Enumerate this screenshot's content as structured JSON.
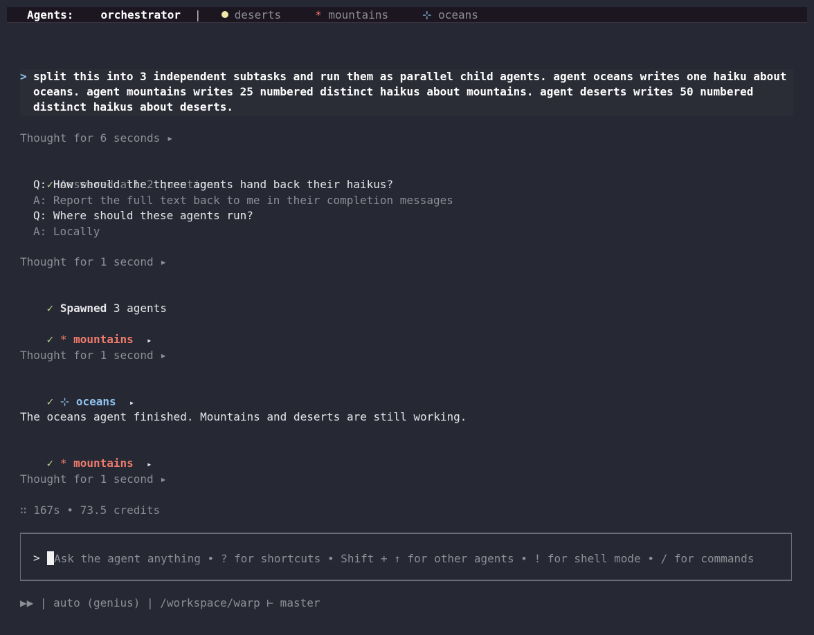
{
  "topbar": {
    "label": "Agents:",
    "current": "orchestrator",
    "separator": "|",
    "agents": [
      {
        "name": "deserts",
        "marker": "dot",
        "color": "#f1e8a6"
      },
      {
        "name": "mountains",
        "marker": "*",
        "color": "#f07c6c"
      },
      {
        "name": "oceans",
        "marker": "⊹",
        "color": "#8fc3ef"
      }
    ]
  },
  "prompt": {
    "caret": ">",
    "text": "split this into 3 independent subtasks and run them as parallel child agents. agent oceans writes one haiku about oceans. agent mountains writes 25 numbered distinct haikus about mountains. agent deserts writes 50 numbered distinct haikus about deserts."
  },
  "transcript": {
    "thought1": "Thought for 6 seconds ▸",
    "check": "✓",
    "answered": "Answered all 2 questions",
    "q1": "Q: How should the three agents hand back their haikus?",
    "a1": "A: Report the full text back to me in their completion messages",
    "q2": "Q: Where should these agents run?",
    "a2": "A: Locally",
    "thought2": "Thought for 1 second ▸",
    "spawned_bold": "Spawned",
    "spawned_rest": " 3 agents",
    "mountains_marker": "*",
    "mountains_label": "mountains",
    "expand": "▸",
    "thought3": "Thought for 1 second ▸",
    "oceans_marker": "⊹",
    "oceans_label": "oceans",
    "status_message": "The oceans agent finished. Mountains and deserts are still working.",
    "thought4": "Thought for 1 second ▸",
    "stats": "∷ 167s • 73.5 credits"
  },
  "input": {
    "caret": ">",
    "placeholder": "Ask the agent anything • ? for shortcuts • Shift + ↑ for other agents • ! for shell mode • / for commands"
  },
  "statusbar": {
    "text": "▶▶ | auto (genius) | /workspace/warp ⊢ master"
  },
  "colors": {
    "background": "#262833",
    "accent_blue": "#8fc3ef",
    "accent_orange": "#f07c6c",
    "check_green": "#b6d48a"
  }
}
